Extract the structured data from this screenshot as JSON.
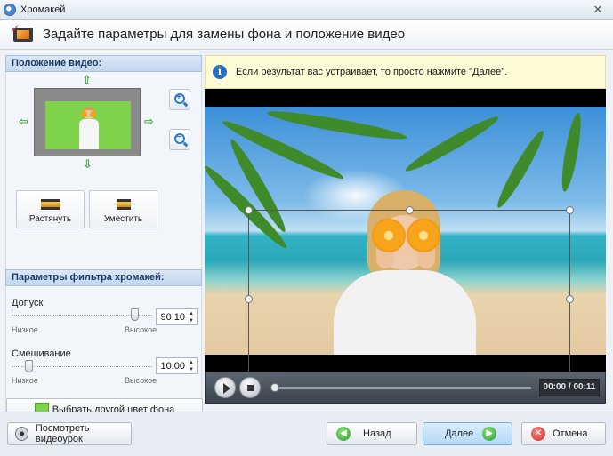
{
  "window": {
    "title": "Хромакей",
    "close_label": "✕"
  },
  "header": {
    "title": "Задайте параметры для замены фона и положение видео"
  },
  "position": {
    "heading": "Положение видео:",
    "stretch_label": "Растянуть",
    "fit_label": "Уместить"
  },
  "filter": {
    "heading": "Параметры фильтра хромакей:",
    "tolerance": {
      "label": "Допуск",
      "value": "90.10",
      "min_label": "Низкое",
      "max_label": "Высокое",
      "level": 0.9
    },
    "blend": {
      "label": "Смешивание",
      "value": "10.00",
      "min_label": "Низкое",
      "max_label": "Высокое",
      "level": 0.1
    },
    "pick_color_label": "Выбрать другой цвет фона",
    "key_color": "#7fd34a"
  },
  "info": {
    "text": "Если результат вас устраивает, то просто нажмите \"Далее\"."
  },
  "player": {
    "time": "00:00 / 00:11",
    "progress": 0
  },
  "footer": {
    "tutorial_label": "Посмотреть видеоурок",
    "back_label": "Назад",
    "next_label": "Далее",
    "cancel_label": "Отмена"
  }
}
